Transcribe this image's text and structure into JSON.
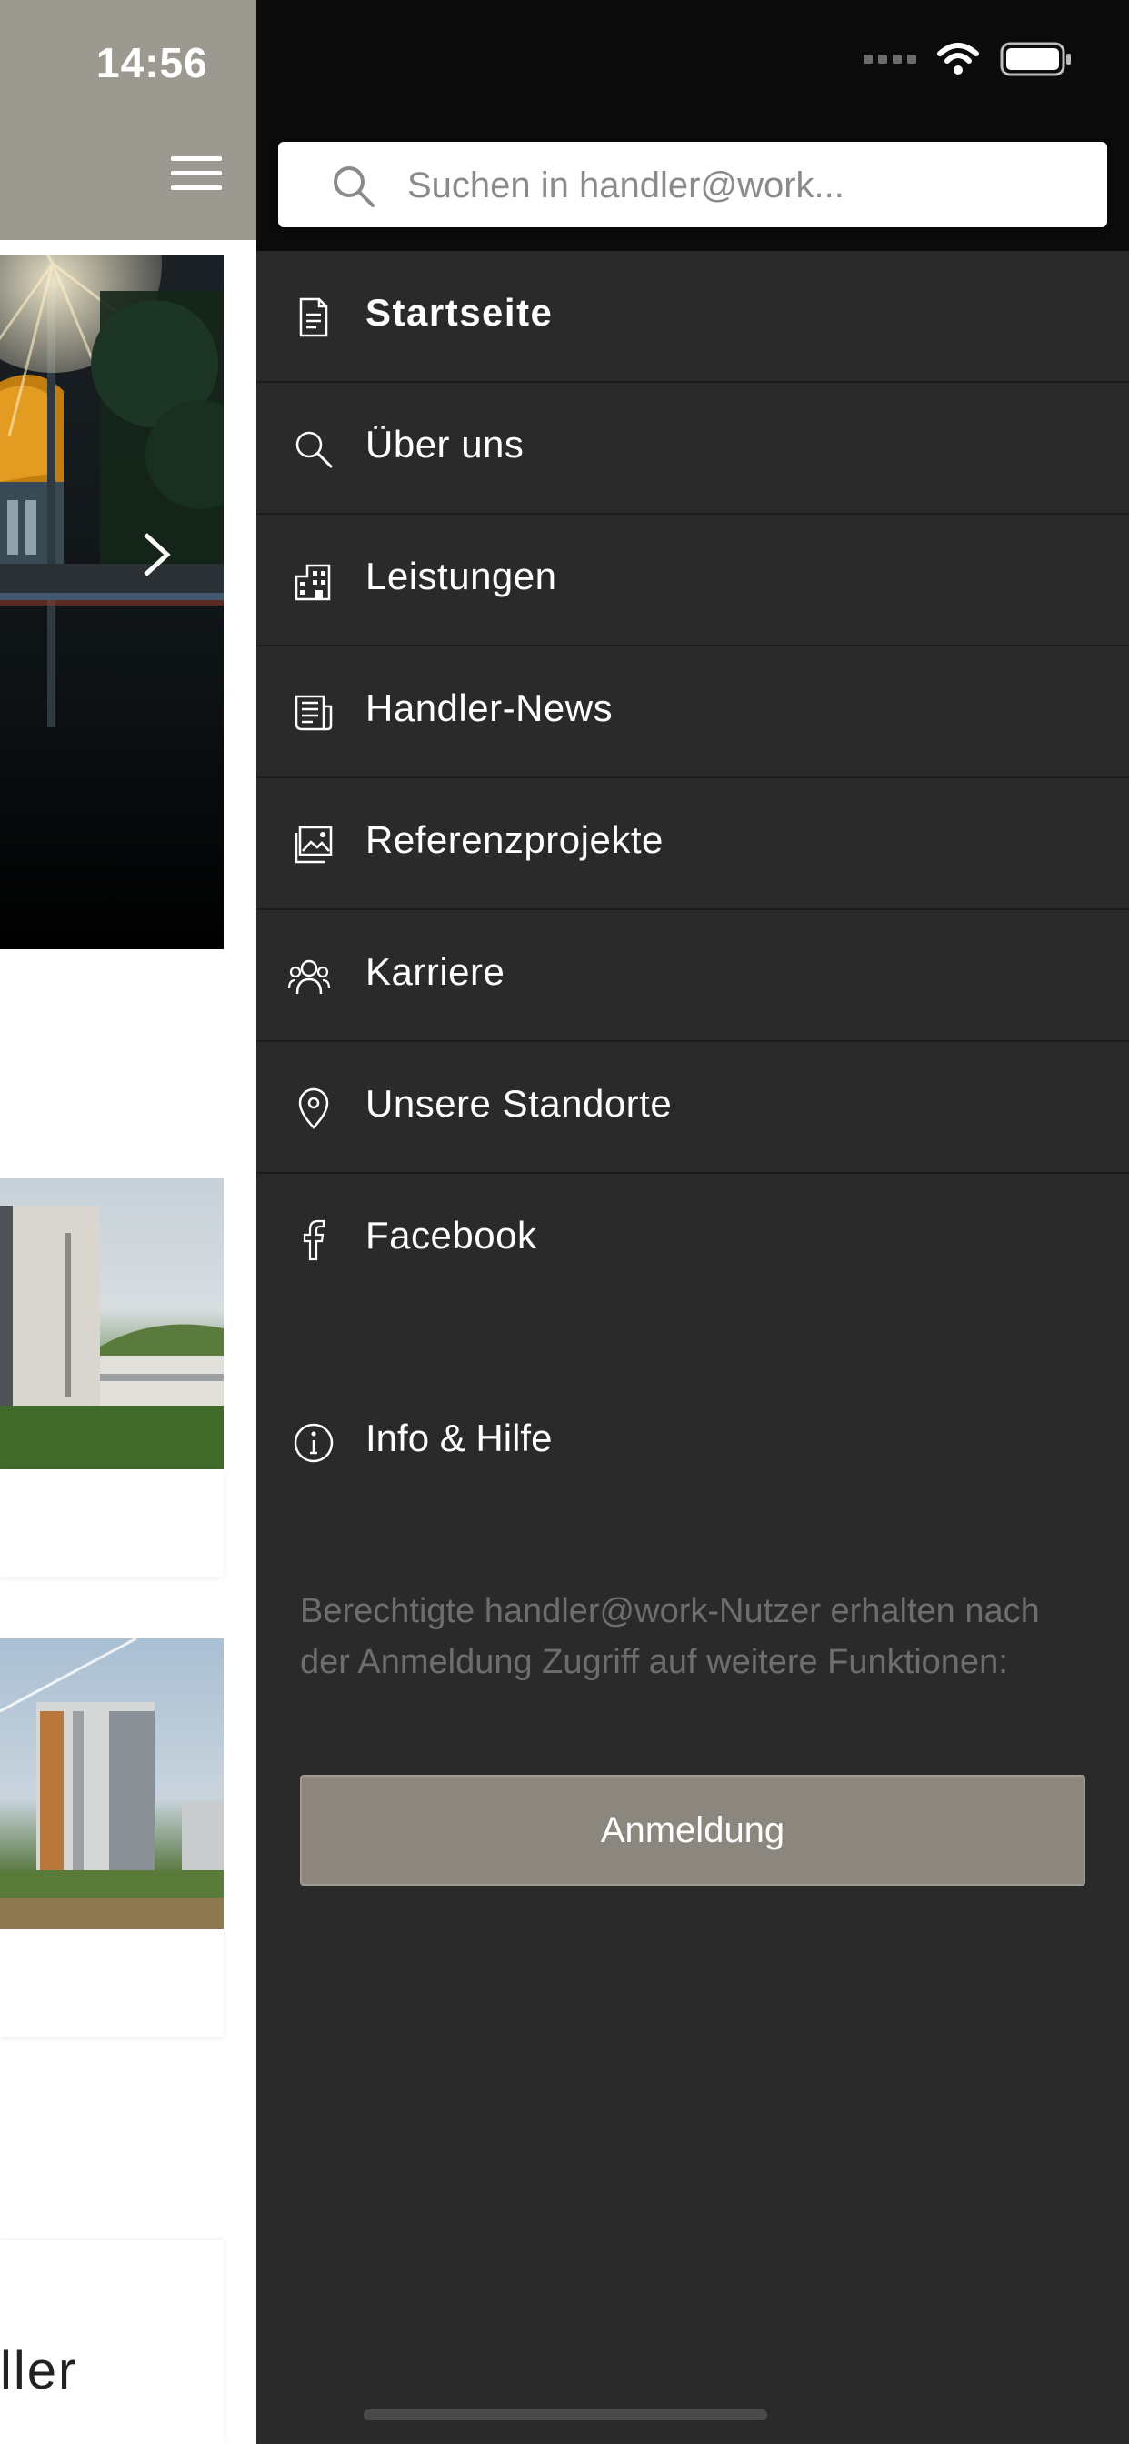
{
  "status_bar": {
    "time": "14:56"
  },
  "search": {
    "placeholder": "Suchen in handler@work..."
  },
  "menu": {
    "items": [
      {
        "label": "Startseite",
        "icon": "document-icon",
        "active": true
      },
      {
        "label": "Über uns",
        "icon": "search-icon"
      },
      {
        "label": "Leistungen",
        "icon": "building-icon"
      },
      {
        "label": "Handler-News",
        "icon": "newspaper-icon"
      },
      {
        "label": "Referenzprojekte",
        "icon": "image-gallery-icon"
      },
      {
        "label": "Karriere",
        "icon": "people-icon"
      },
      {
        "label": "Unsere Standorte",
        "icon": "location-pin-icon"
      },
      {
        "label": "Facebook",
        "icon": "facebook-icon"
      }
    ],
    "info": {
      "label": "Info & Hilfe",
      "icon": "info-icon"
    }
  },
  "login": {
    "note": "Berechtigte handler@work-Nutzer erhalten nach der Anmeldung Zugriff auf weitere Funktionen:",
    "button_label": "Anmeldung"
  },
  "background_page": {
    "card_title_fragment": "ller"
  },
  "colors": {
    "drawer_bg": "#2a2a2a",
    "drawer_top_bg": "#0b0b0b",
    "header_bg": "#9b9990",
    "button_bg": "#8c877e",
    "note_text": "#6e6e6e"
  }
}
